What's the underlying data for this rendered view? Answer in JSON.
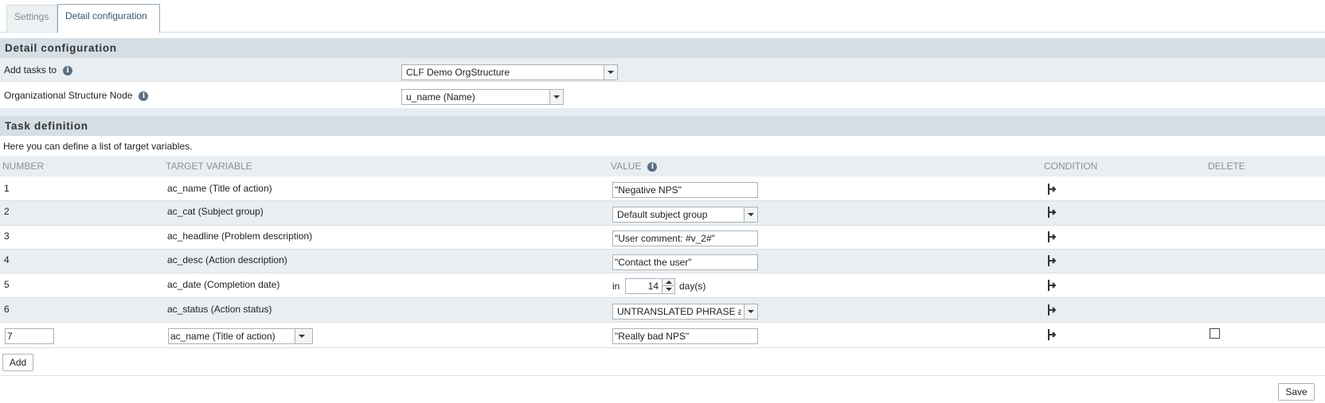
{
  "tabs": [
    {
      "label": "Settings",
      "active": false
    },
    {
      "label": "Detail configuration",
      "active": true
    }
  ],
  "detail": {
    "heading": "Detail configuration",
    "add_tasks_label": "Add tasks to",
    "add_tasks_value": "CLF Demo OrgStructure",
    "org_node_label": "Organizational Structure Node",
    "org_node_value": "u_name (Name)"
  },
  "task": {
    "heading": "Task definition",
    "description": "Here you can define a list of target variables.",
    "columns": {
      "number": "NUMBER",
      "target": "TARGET VARIABLE",
      "value": "VALUE",
      "condition": "CONDITION",
      "delete": "DELETE"
    },
    "rows": [
      {
        "number": "1",
        "target": "ac_name (Title of action)",
        "value": "\"Negative NPS\""
      },
      {
        "number": "2",
        "target": "ac_cat (Subject group)",
        "value": "Default subject group"
      },
      {
        "number": "3",
        "target": "ac_headline (Problem description)",
        "value": "\"User comment: #v_2#\""
      },
      {
        "number": "4",
        "target": "ac_desc (Action description)",
        "value": "\"Contact the user\""
      },
      {
        "number": "5",
        "target": "ac_date (Completion date)",
        "value_prefix": "in",
        "value": "14",
        "value_suffix": "day(s)"
      },
      {
        "number": "6",
        "target": "ac_status (Action status)",
        "value": "UNTRANSLATED PHRASE ac"
      },
      {
        "number": "7",
        "target": "ac_name (Title of action)",
        "value": "\"Really bad NPS\""
      }
    ]
  },
  "buttons": {
    "add": "Add",
    "save": "Save"
  },
  "icons": {
    "info": "info-icon",
    "condition": "condition-branch-icon"
  }
}
